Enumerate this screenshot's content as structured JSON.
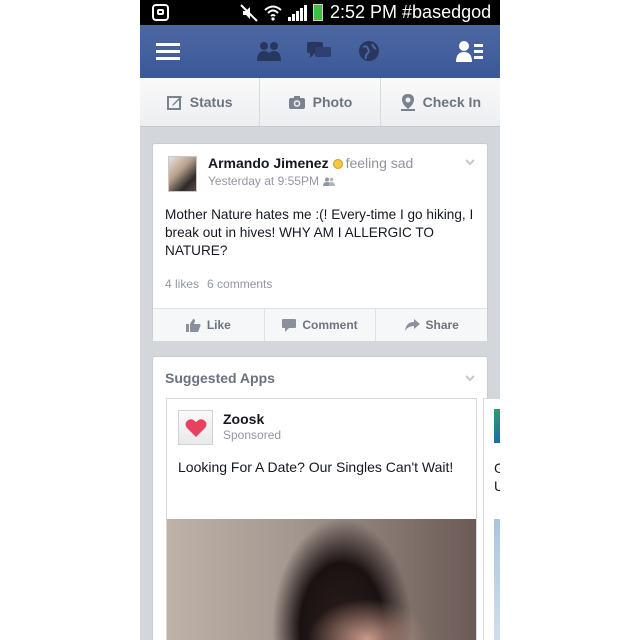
{
  "status_bar": {
    "text": "2:52 PM #basedgod",
    "icons": [
      "app-icon",
      "mute-icon",
      "wifi-icon",
      "signal-icon",
      "battery-icon"
    ]
  },
  "navbar": {
    "icons": [
      "menu-icon",
      "friend-requests-icon",
      "messages-icon",
      "notifications-globe-icon",
      "friends-list-icon"
    ],
    "color": "#3b5998"
  },
  "publisher": {
    "status_label": "Status",
    "photo_label": "Photo",
    "checkin_label": "Check In"
  },
  "post": {
    "author": "Armando Jimenez",
    "feeling": "feeling sad",
    "timestamp": "Yesterday at 9:55PM",
    "text": "Mother Nature hates me :(! Every-time I go hiking, I break out in hives! WHY AM I ALLERGIC TO NATURE?",
    "likes": "4 likes",
    "comments": "6 comments",
    "like_label": "Like",
    "comment_label": "Comment",
    "share_label": "Share"
  },
  "suggested_apps": {
    "title": "Suggested Apps",
    "apps": [
      {
        "name": "Zoosk",
        "sponsored": "Sponsored",
        "description": "Looking For A Date? Our Singles Can't Wait!"
      },
      {
        "description_partial": "G\nU"
      }
    ]
  }
}
